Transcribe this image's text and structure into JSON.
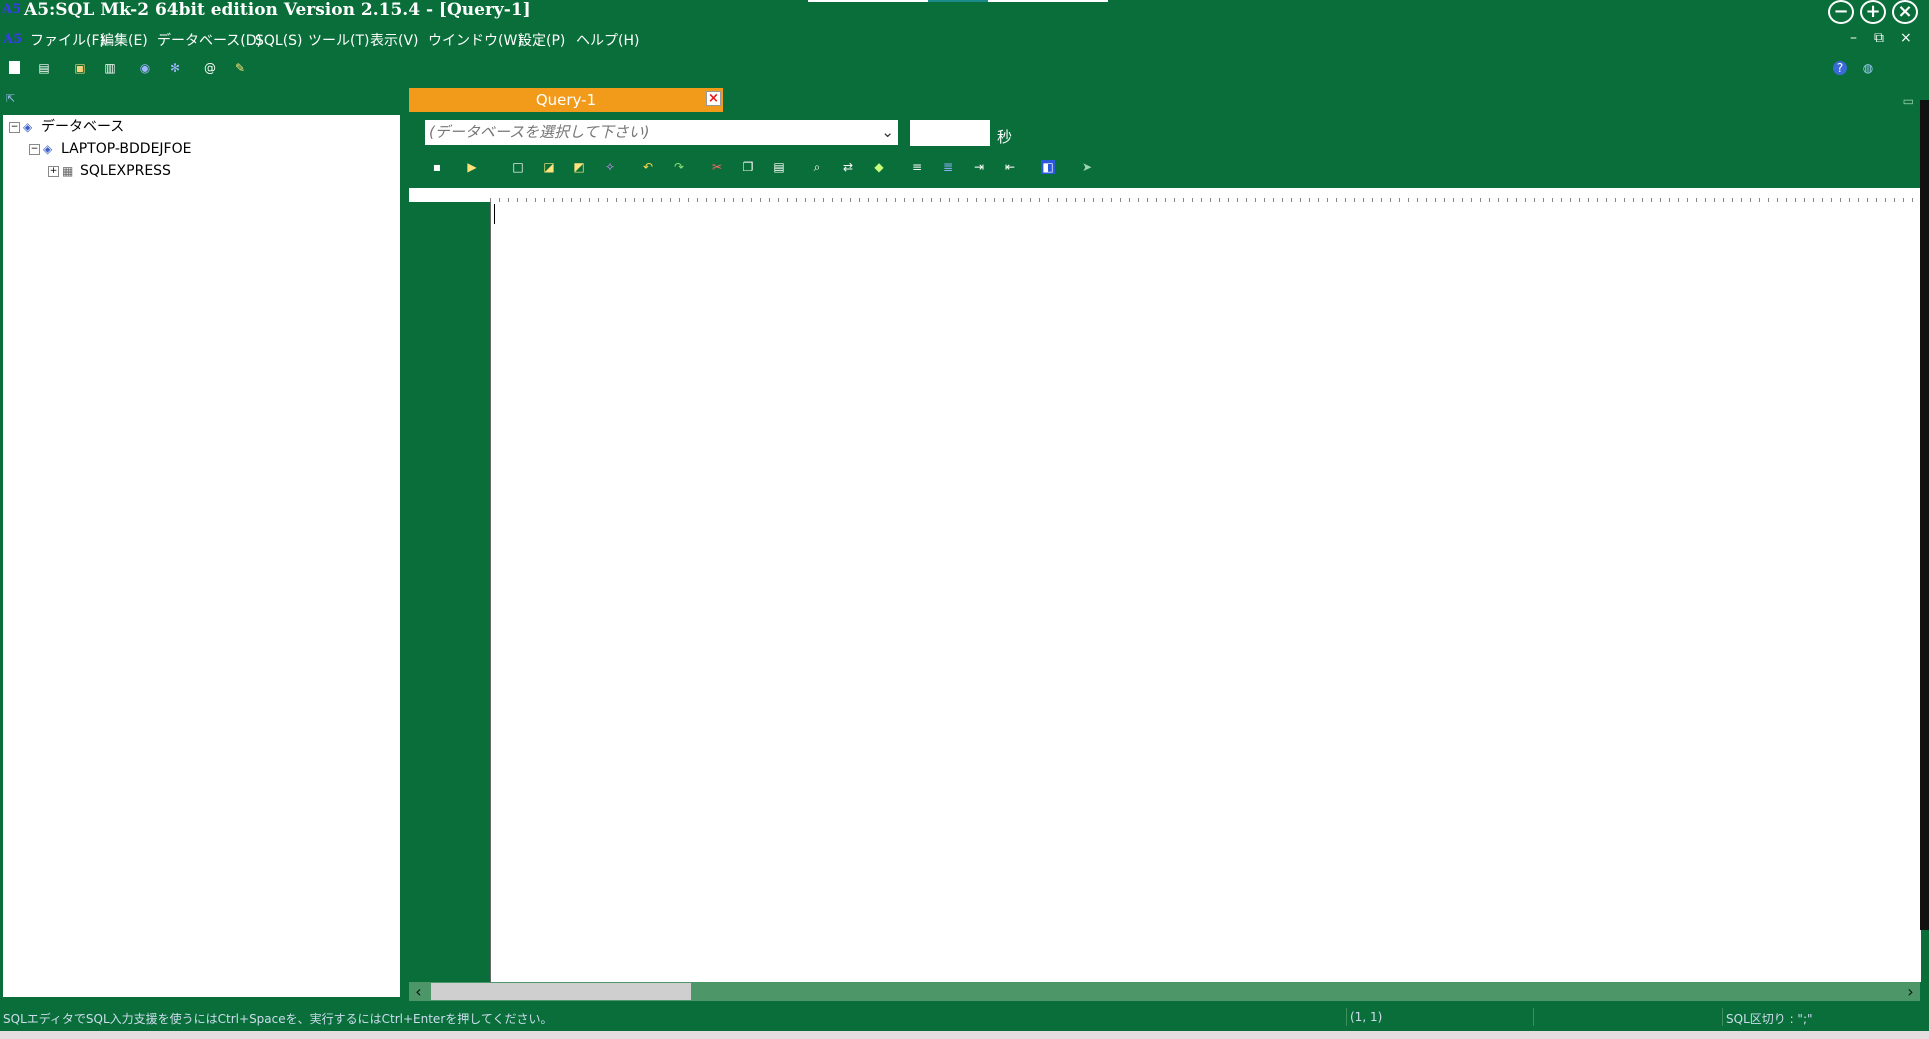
{
  "window": {
    "title": "A5:SQL Mk-2 64bit edition Version 2.15.4 - [Query-1]",
    "app_icon_text": "A5",
    "minimize_label": "−",
    "maximize_label": "+",
    "close_label": "×"
  },
  "menu": {
    "items": [
      "ファイル(F)",
      "編集(E)",
      "データベース(D)",
      "SQL(S)",
      "ツール(T)",
      "表示(V)",
      "ウインドウ(W)",
      "設定(P)",
      "ヘルプ(H)"
    ],
    "mdi_minimize": "–",
    "mdi_restore": "⧉",
    "mdi_close": "×"
  },
  "tree": {
    "root": "データベース",
    "server": "LAPTOP-BDDEJFOE",
    "instance": "SQLEXPRESS"
  },
  "tabs": [
    {
      "label": "Query-1"
    }
  ],
  "editor_toolbar": {
    "db_select_placeholder": "(データベースを選択して下さい)",
    "seconds_label": "秒"
  },
  "status": {
    "hint": "SQLエディタでSQL入力支援を使うにはCtrl+Spaceを、実行するにはCtrl+Enterを押してください。",
    "cursor_pos": "(1, 1)",
    "delimiter": "SQL区切り : \";\""
  },
  "colors": {
    "background": "#0a6e3a",
    "tab_active": "#f29a1a",
    "editor_bg": "#ffffff"
  }
}
